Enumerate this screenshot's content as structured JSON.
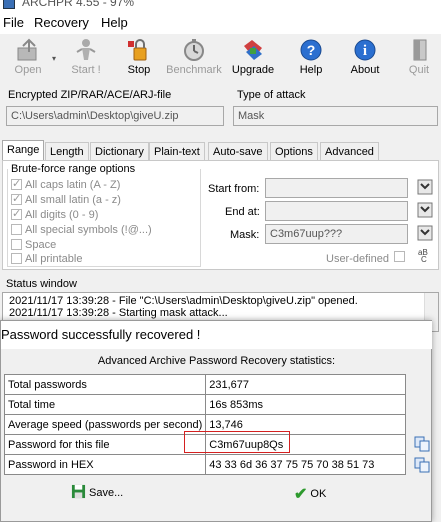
{
  "window": {
    "title": "ARCHPR 4.55 - 97%"
  },
  "menu": [
    "File",
    "Recovery",
    "Help"
  ],
  "toolbar": [
    {
      "label": "Open",
      "icon": "open-icon",
      "enabled": false
    },
    {
      "label": "Start !",
      "icon": "start-icon",
      "enabled": false
    },
    {
      "label": "Stop",
      "icon": "stop-icon",
      "enabled": true
    },
    {
      "label": "Benchmark",
      "icon": "benchmark-icon",
      "enabled": false
    },
    {
      "label": "Upgrade",
      "icon": "upgrade-icon",
      "enabled": true
    },
    {
      "label": "Help",
      "icon": "help-icon",
      "enabled": true
    },
    {
      "label": "About",
      "icon": "about-icon",
      "enabled": true
    },
    {
      "label": "Quit",
      "icon": "quit-icon",
      "enabled": false
    }
  ],
  "file_section": {
    "label": "Encrypted ZIP/RAR/ACE/ARJ-file",
    "path": "C:\\Users\\admin\\Desktop\\giveU.zip"
  },
  "attack_section": {
    "label": "Type of attack",
    "value": "Mask"
  },
  "tabs": [
    "Range",
    "Length",
    "Dictionary",
    "Plain-text",
    "Auto-save",
    "Options",
    "Advanced"
  ],
  "range": {
    "group_label": "Brute-force range options",
    "options": [
      {
        "label": "All caps latin (A - Z)",
        "checked": true
      },
      {
        "label": "All small latin (a - z)",
        "checked": true
      },
      {
        "label": "All digits (0 - 9)",
        "checked": true
      },
      {
        "label": "All special symbols (!@...)",
        "checked": false
      },
      {
        "label": "Space",
        "checked": false
      },
      {
        "label": "All printable",
        "checked": false
      }
    ],
    "start_from_label": "Start from:",
    "end_at_label": "End at:",
    "mask_label": "Mask:",
    "mask_value": "C3m67uup???",
    "user_defined_label": "User-defined"
  },
  "status": {
    "label": "Status window",
    "lines": [
      "2021/11/17 13:39:28 - File \"C:\\Users\\admin\\Desktop\\giveU.zip\" opened.",
      "2021/11/17 13:39:28 - Starting mask attack..."
    ]
  },
  "dialog": {
    "title": "Password successfully recovered !",
    "caption": "Advanced Archive Password Recovery statistics:",
    "rows": [
      {
        "key": "Total passwords",
        "value": "231,677"
      },
      {
        "key": "Total time",
        "value": "16s 853ms"
      },
      {
        "key": "Average speed (passwords per second)",
        "value": "13,746"
      },
      {
        "key": "Password for this file",
        "value": "C3m67uup8Qs"
      },
      {
        "key": "Password in HEX",
        "value": "43 33 6d 36 37 75 75 70 38 51 73"
      }
    ],
    "save_label": "Save...",
    "ok_label": "OK"
  },
  "colors": {
    "highlight_border": "#d42020",
    "ok_check": "#2e9a2e",
    "save_icon": "#2a8a3a"
  }
}
